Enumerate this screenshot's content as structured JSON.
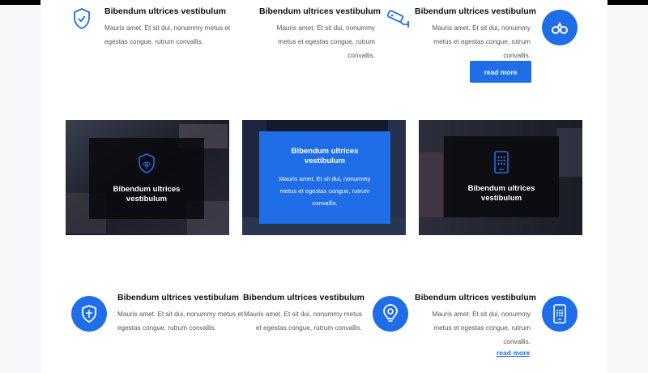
{
  "top_features": [
    {
      "title": "Bibendum ultrices vestibulum",
      "text": "Mauris amet. Et sit dui, nonummy metus et egestas congue, rutrum convallis.",
      "icon": "shield-check-icon"
    },
    {
      "title": "Bibendum ultrices vestibulum",
      "text": "Mauris amet. Et sit dui, nonummy metus et egestas congue, rutrum convallis.",
      "icon": "security-camera-icon"
    },
    {
      "title": "Bibendum ultrices vestibulum",
      "text": "Mauris amet. Et sit dui, nonummy metus et egestas congue, rutrum convallis.",
      "icon": "handcuffs-icon",
      "button": "read more"
    }
  ],
  "cards": [
    {
      "title": "Bibendum ultrices vestibulum",
      "icon": "fingerprint-shield-icon"
    },
    {
      "title": "Bibendum ultrices vestibulum",
      "text": "Mauris amet. Et sit dui, nonummy metus et egestas congue, rutrum convallis."
    },
    {
      "title": "Bibendum ultrices vestibulum",
      "icon": "tablet-keypad-icon"
    }
  ],
  "bottom_features": [
    {
      "title": "Bibendum ultrices vestibulum",
      "text": "Mauris amet. Et sit dui, nonummy metus et egestas congue, rutrum convallis.",
      "icon": "shield-icon"
    },
    {
      "title": "Bibendum ultrices vestibulum",
      "text": "Mauris amet. Et sit dui, nonummy metus et egestas congue, rutrum convallis.",
      "icon": "location-bulb-icon"
    },
    {
      "title": "Bibendum ultrices vestibulum",
      "text": "Mauris amet. Et sit dui, nonummy metus et egestas congue, rutrum convallis.",
      "icon": "mobile-keypad-icon",
      "link": "read more"
    }
  ],
  "colors": {
    "accent": "#1f6ee8",
    "dark": "#0a0a0e"
  }
}
